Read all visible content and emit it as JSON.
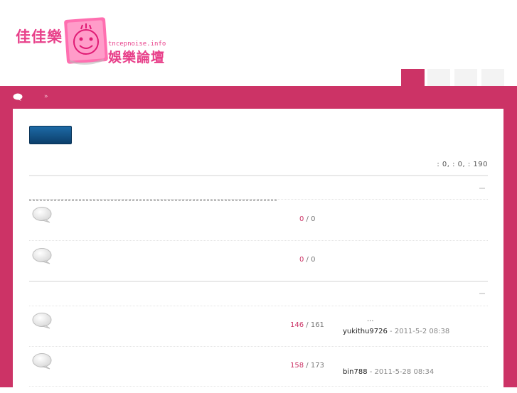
{
  "logo": {
    "left_text": "佳佳樂",
    "right_text": "娛樂論壇",
    "domain": "tncepnoise.info"
  },
  "stats": {
    "text": ": 0,   : 0,   : 190"
  },
  "breadcrumb": {
    "separator": "»"
  },
  "sections": [
    {
      "forums": [
        {
          "posts": "0",
          "separator": " / ",
          "replies": "0"
        },
        {
          "posts": "0",
          "separator": " / ",
          "replies": "0"
        }
      ]
    },
    {
      "forums": [
        {
          "posts": "146",
          "separator": " / ",
          "replies": "161",
          "last_title": "...",
          "last_user": "yukithu9726",
          "last_time": " - 2011-5-2 08:38"
        },
        {
          "posts": "158",
          "separator": " / ",
          "replies": "173",
          "last_user": "bin788",
          "last_time": " - 2011-5-28 08:34"
        }
      ]
    }
  ],
  "colors": {
    "accent": "#cc3366",
    "button": "#0c3f6b",
    "logo": "#e8408a"
  },
  "icons": [
    "home-icon",
    "forum-bubble-icon"
  ]
}
